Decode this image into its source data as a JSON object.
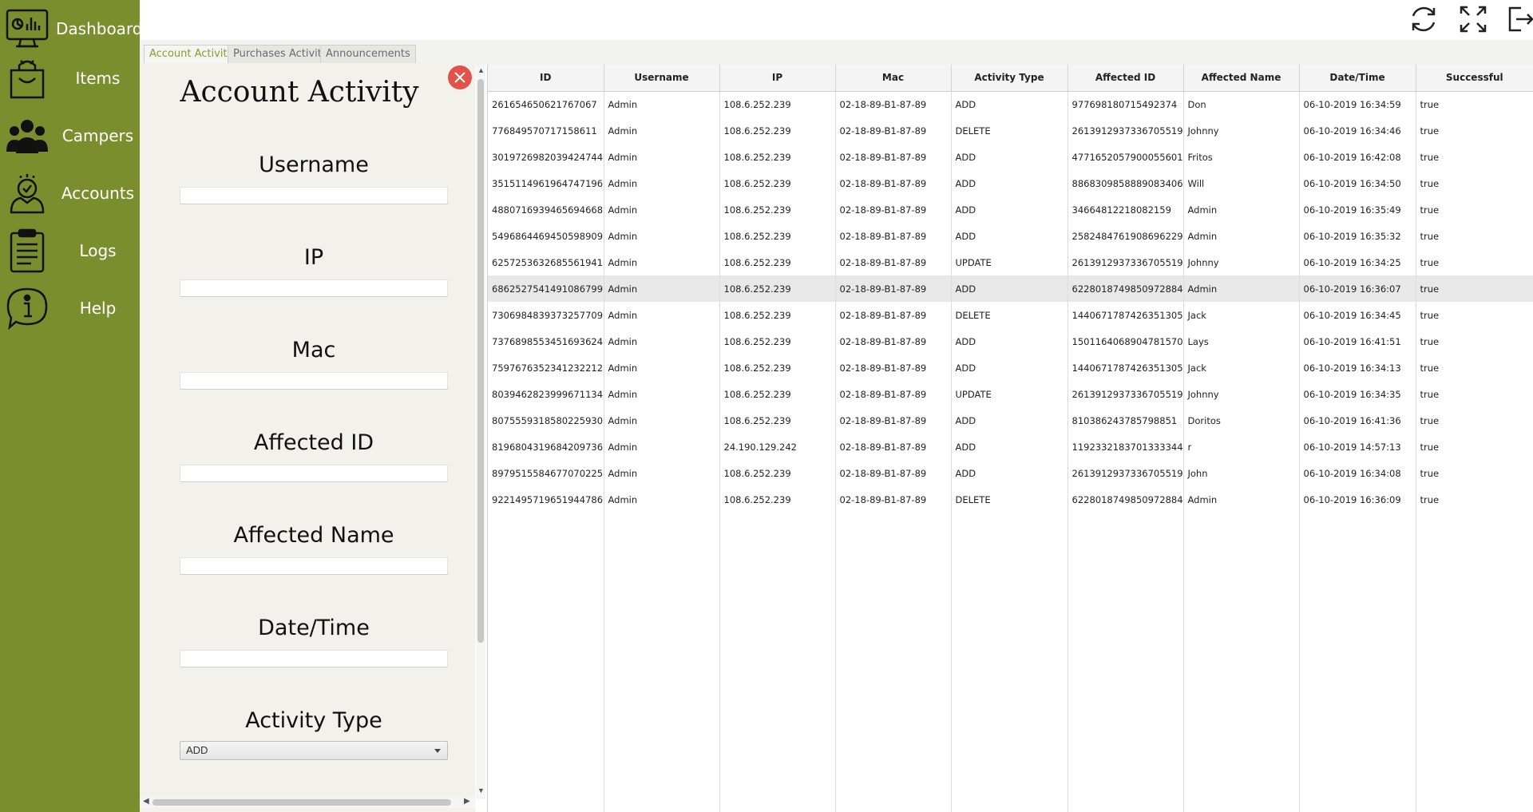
{
  "sidebar": {
    "items": [
      {
        "label": "Dashboard",
        "icon": "dashboard-monitor-icon"
      },
      {
        "label": "Items",
        "icon": "shopping-bag-icon"
      },
      {
        "label": "Campers",
        "icon": "people-group-icon"
      },
      {
        "label": "Accounts",
        "icon": "user-account-icon"
      },
      {
        "label": "Logs",
        "icon": "clipboard-icon"
      },
      {
        "label": "Help",
        "icon": "info-icon"
      }
    ],
    "background": "#7b8e2e"
  },
  "topbar": {
    "refresh_icon": "refresh-icon",
    "fullscreen_icon": "expand-icon",
    "logout_icon": "logout-icon"
  },
  "tabs": [
    {
      "label": "Account Activity",
      "active": true
    },
    {
      "label": "Purchases Activity",
      "active": false
    },
    {
      "label": "Announcements",
      "active": false
    }
  ],
  "form": {
    "title": "Account Activity",
    "fields": [
      {
        "label": "Username",
        "value": ""
      },
      {
        "label": "IP",
        "value": ""
      },
      {
        "label": "Mac",
        "value": ""
      },
      {
        "label": "Affected ID",
        "value": ""
      },
      {
        "label": "Affected Name",
        "value": ""
      },
      {
        "label": "Date/Time",
        "value": ""
      }
    ],
    "activity_type": {
      "label": "Activity Type",
      "selected": "ADD"
    }
  },
  "table": {
    "columns": [
      "ID",
      "Username",
      "IP",
      "Mac",
      "Activity Type",
      "Affected ID",
      "Affected Name",
      "Date/Time",
      "Successful"
    ],
    "selected_row": 7,
    "rows": [
      [
        "261654650621767067",
        "Admin",
        "108.6.252.239",
        "02-18-89-B1-87-89",
        "ADD",
        "977698180715492374",
        "Don",
        "06-10-2019 16:34:59",
        "true"
      ],
      [
        "776849570717158611",
        "Admin",
        "108.6.252.239",
        "02-18-89-B1-87-89",
        "DELETE",
        "2613912937336705519",
        "Johnny",
        "06-10-2019 16:34:46",
        "true"
      ],
      [
        "3019726982039424744",
        "Admin",
        "108.6.252.239",
        "02-18-89-B1-87-89",
        "ADD",
        "4771652057900055601",
        "Fritos",
        "06-10-2019 16:42:08",
        "true"
      ],
      [
        "3515114961964747196",
        "Admin",
        "108.6.252.239",
        "02-18-89-B1-87-89",
        "ADD",
        "8868309858889083406",
        "Will",
        "06-10-2019 16:34:50",
        "true"
      ],
      [
        "4880716939465694668",
        "Admin",
        "108.6.252.239",
        "02-18-89-B1-87-89",
        "ADD",
        "34664812218082159",
        "Admin",
        "06-10-2019 16:35:49",
        "true"
      ],
      [
        "5496864469450598909",
        "Admin",
        "108.6.252.239",
        "02-18-89-B1-87-89",
        "ADD",
        "2582484761908696229",
        "Admin",
        "06-10-2019 16:35:32",
        "true"
      ],
      [
        "6257253632685561941",
        "Admin",
        "108.6.252.239",
        "02-18-89-B1-87-89",
        "UPDATE",
        "2613912937336705519",
        "Johnny",
        "06-10-2019 16:34:25",
        "true"
      ],
      [
        "6862527541491086799",
        "Admin",
        "108.6.252.239",
        "02-18-89-B1-87-89",
        "ADD",
        "6228018749850972884",
        "Admin",
        "06-10-2019 16:36:07",
        "true"
      ],
      [
        "7306984839373257709",
        "Admin",
        "108.6.252.239",
        "02-18-89-B1-87-89",
        "DELETE",
        "1440671787426351305",
        "Jack",
        "06-10-2019 16:34:45",
        "true"
      ],
      [
        "7376898553451693624",
        "Admin",
        "108.6.252.239",
        "02-18-89-B1-87-89",
        "ADD",
        "1501164068904781570",
        "Lays",
        "06-10-2019 16:41:51",
        "true"
      ],
      [
        "7597676352341232212",
        "Admin",
        "108.6.252.239",
        "02-18-89-B1-87-89",
        "ADD",
        "1440671787426351305",
        "Jack",
        "06-10-2019 16:34:13",
        "true"
      ],
      [
        "8039462823999671134",
        "Admin",
        "108.6.252.239",
        "02-18-89-B1-87-89",
        "UPDATE",
        "2613912937336705519",
        "Johnny",
        "06-10-2019 16:34:35",
        "true"
      ],
      [
        "8075559318580225930",
        "Admin",
        "108.6.252.239",
        "02-18-89-B1-87-89",
        "ADD",
        "810386243785798851",
        "Doritos",
        "06-10-2019 16:41:36",
        "true"
      ],
      [
        "8196804319684209736",
        "Admin",
        "24.190.129.242",
        "02-18-89-B1-87-89",
        "ADD",
        "1192332183701333344",
        "r",
        "06-10-2019 14:57:13",
        "true"
      ],
      [
        "8979515584677070225",
        "Admin",
        "108.6.252.239",
        "02-18-89-B1-87-89",
        "ADD",
        "2613912937336705519",
        "John",
        "06-10-2019 16:34:08",
        "true"
      ],
      [
        "9221495719651944786",
        "Admin",
        "108.6.252.239",
        "02-18-89-B1-87-89",
        "DELETE",
        "6228018749850972884",
        "Admin",
        "06-10-2019 16:36:09",
        "true"
      ]
    ]
  }
}
